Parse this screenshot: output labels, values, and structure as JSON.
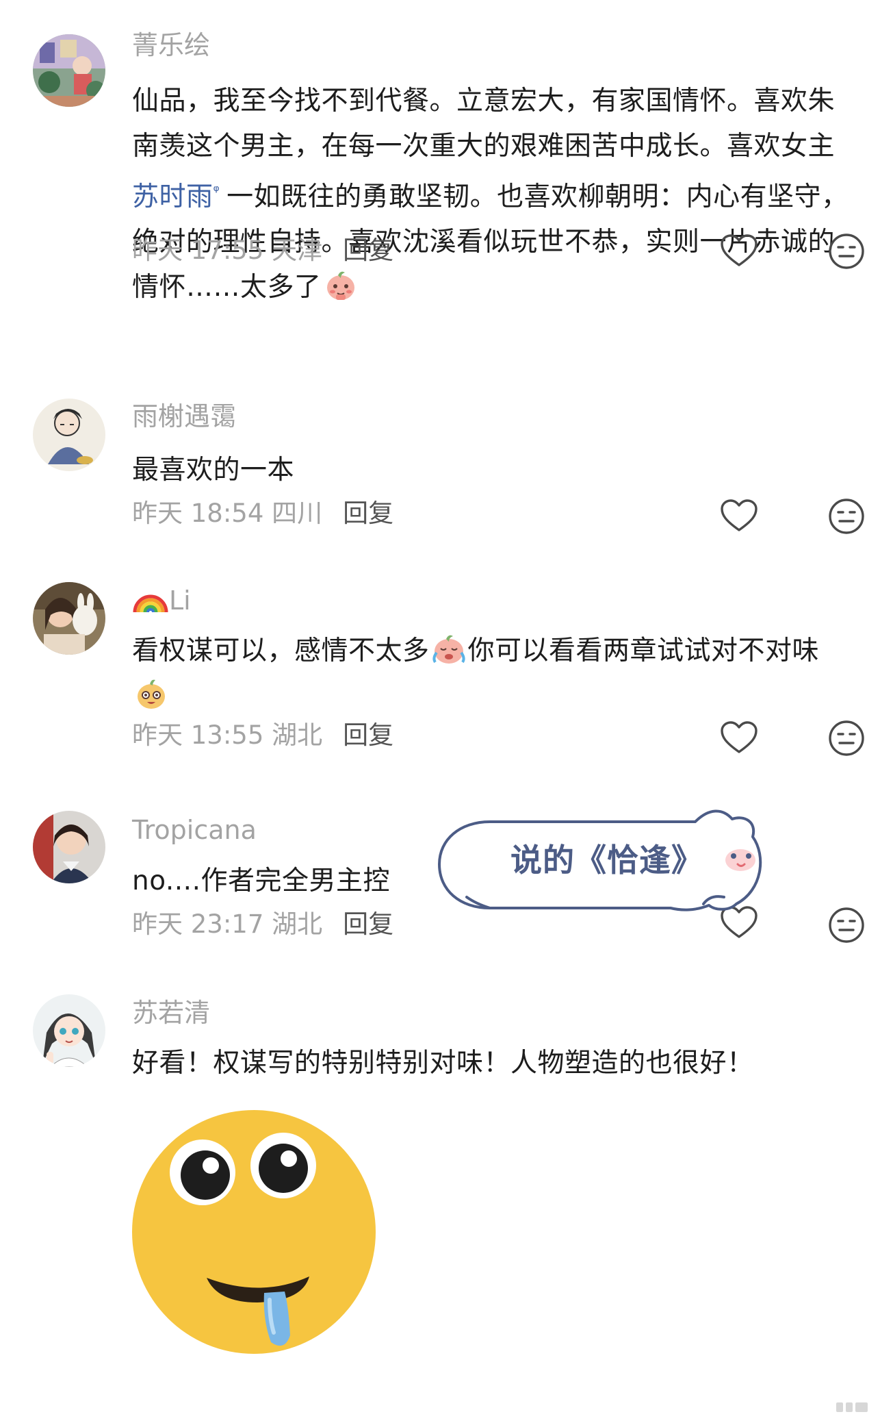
{
  "comments": [
    {
      "username": "菁乐绘",
      "text_before_link": "仙品，我至今找不到代餐。立意宏大，有家国情怀。喜欢朱南羡这个男主，在每一次重大的艰难困苦中成长。喜欢女主 ",
      "link_text": "苏时雨",
      "link_mark": "ᵠ",
      "text_after_link": "一如既往的勇敢坚韧。也喜欢柳朝明：内心有坚守，绝对的理性自持。喜欢沈溪看似玩世不恭，实则一片赤诚的情怀……太多了",
      "time": "昨天 17:55",
      "location": "天津",
      "reply_label": "回复"
    },
    {
      "username": "雨榭遇霭",
      "text": "最喜欢的一本",
      "time": "昨天 18:54",
      "location": "四川",
      "reply_label": "回复"
    },
    {
      "username": "Li",
      "text_part1": "看权谋可以，感情不太多",
      "text_part2": "你可以看看两章试试对不对味",
      "time": "昨天 13:55",
      "location": "湖北",
      "reply_label": "回复"
    },
    {
      "username": "Tropicana",
      "text": "no....作者完全男主控",
      "time": "昨天 23:17",
      "location": "湖北",
      "reply_label": "回复"
    },
    {
      "username": "苏若清",
      "text": "好看！权谋写的特别特别对味！人物塑造的也很好！"
    }
  ],
  "sticker_bubble": {
    "text": "说的《恰逢》"
  },
  "colors": {
    "username_gray": "#a3a3a3",
    "link_blue": "#3e61a4",
    "reply_dark": "#545454",
    "emoji_yellow": "#f6c540",
    "bubble_outline": "#4c5c86"
  },
  "icons": [
    "heart-icon",
    "neutral-face-icon",
    "rainbow-emoji",
    "crying-emoji",
    "peach-blush-emoji",
    "drooling-face-emoji"
  ]
}
